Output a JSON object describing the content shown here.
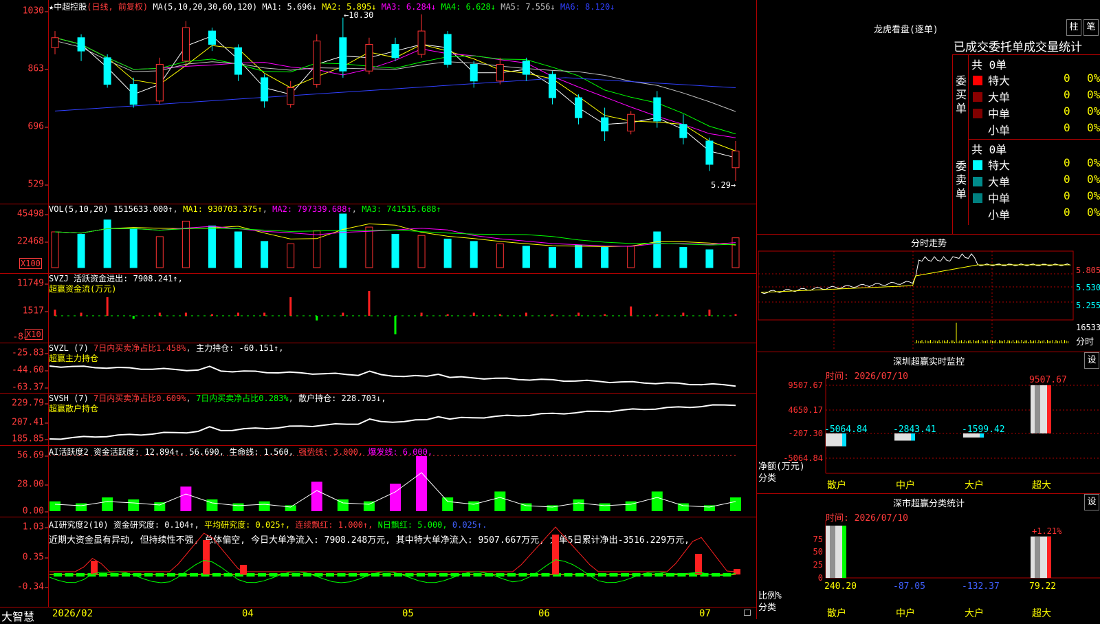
{
  "main": {
    "stock": "中超控股",
    "mode": "(日线, 前复权)",
    "ma_param": "MA(5,10,20,30,60,120)",
    "ma": [
      {
        "label": "MA1: 5.696↓",
        "color": "#ffffff"
      },
      {
        "label": "MA2: 5.895↓",
        "color": "#ffff00"
      },
      {
        "label": "MA3: 6.284↓",
        "color": "#ff00ff"
      },
      {
        "label": "MA4: 6.628↓",
        "color": "#00ff00"
      },
      {
        "label": "MA5: 7.556↓",
        "color": "#c0c0c0"
      },
      {
        "label": "MA6: 8.120↓",
        "color": "#3040ff"
      }
    ],
    "y_ticks": [
      "1030",
      "863",
      "696",
      "529"
    ],
    "high_label": "←10.30",
    "low_label": "5.29→"
  },
  "candles": [
    {
      "o": 9.3,
      "c": 9.6,
      "h": 9.8,
      "l": 9.1
    },
    {
      "o": 9.6,
      "c": 9.2,
      "h": 9.7,
      "l": 8.9
    },
    {
      "o": 9.0,
      "c": 8.2,
      "h": 9.1,
      "l": 8.1
    },
    {
      "o": 8.2,
      "c": 7.6,
      "h": 8.4,
      "l": 7.5
    },
    {
      "o": 7.7,
      "c": 8.8,
      "h": 9.0,
      "l": 7.6
    },
    {
      "o": 8.9,
      "c": 9.9,
      "h": 10.1,
      "l": 8.8
    },
    {
      "o": 9.8,
      "c": 9.4,
      "h": 9.9,
      "l": 9.2
    },
    {
      "o": 9.3,
      "c": 8.5,
      "h": 9.4,
      "l": 8.3
    },
    {
      "o": 8.4,
      "c": 7.7,
      "h": 8.5,
      "l": 7.5
    },
    {
      "o": 7.6,
      "c": 8.1,
      "h": 8.3,
      "l": 7.5
    },
    {
      "o": 8.2,
      "c": 9.5,
      "h": 9.7,
      "l": 8.1
    },
    {
      "o": 9.6,
      "c": 8.6,
      "h": 10.2,
      "l": 8.4
    },
    {
      "o": 8.6,
      "c": 9.4,
      "h": 9.6,
      "l": 8.5
    },
    {
      "o": 9.4,
      "c": 9.0,
      "h": 9.6,
      "l": 8.9
    },
    {
      "o": 9.1,
      "c": 9.8,
      "h": 10.3,
      "l": 9.0
    },
    {
      "o": 9.7,
      "c": 8.8,
      "h": 9.8,
      "l": 8.7
    },
    {
      "o": 8.8,
      "c": 8.3,
      "h": 8.9,
      "l": 8.1
    },
    {
      "o": 8.3,
      "c": 8.8,
      "h": 9.0,
      "l": 8.2
    },
    {
      "o": 8.9,
      "c": 8.5,
      "h": 9.0,
      "l": 8.3
    },
    {
      "o": 8.5,
      "c": 7.8,
      "h": 8.6,
      "l": 7.6
    },
    {
      "o": 7.8,
      "c": 7.2,
      "h": 7.9,
      "l": 7.0
    },
    {
      "o": 7.2,
      "c": 6.8,
      "h": 7.5,
      "l": 6.5
    },
    {
      "o": 6.8,
      "c": 7.3,
      "h": 7.4,
      "l": 6.7
    },
    {
      "o": 7.8,
      "c": 7.1,
      "h": 8.0,
      "l": 6.9
    },
    {
      "o": 7.0,
      "c": 6.6,
      "h": 7.3,
      "l": 6.4
    },
    {
      "o": 6.5,
      "c": 5.8,
      "h": 6.6,
      "l": 5.6
    },
    {
      "o": 5.7,
      "c": 6.2,
      "h": 6.5,
      "l": 5.3
    }
  ],
  "vol": {
    "title": "VOL(5,10,20)",
    "value": "1515633.000↑",
    "ma1": "MA1: 930703.375↑",
    "ma2": "MA2: 797339.688↑",
    "ma3": "MA3: 741515.688↑",
    "y_ticks": [
      "45498",
      "22468"
    ],
    "unit": "X100",
    "values": [
      30,
      28,
      40,
      33,
      26,
      39,
      35,
      30,
      22,
      20,
      31,
      45,
      34,
      28,
      27,
      24,
      22,
      20,
      18,
      17,
      19,
      17,
      18,
      30,
      17,
      15,
      25
    ]
  },
  "svzj": {
    "title": "SVZJ",
    "line1": "活跃资金进出: 7908.241↑,",
    "line2": "超赢资金流(万元)",
    "y_ticks": [
      "11749",
      "1517",
      "-8"
    ],
    "unit": "X10",
    "values": [
      0.2,
      0.1,
      0.6,
      -0.1,
      0.1,
      0.1,
      0.05,
      0.1,
      0.1,
      0.6,
      -0.15,
      0.1,
      0.8,
      -0.6,
      0.1,
      0.05,
      0.1,
      0.05,
      0.1,
      0.05,
      0.1,
      0.05,
      0.3,
      0.05,
      0.1,
      0.2,
      0.05
    ]
  },
  "svzl": {
    "title": "SVZL (7)",
    "line1a": "7日内买卖净占比1.458%",
    "line1b": "主力持仓: -60.151↑,",
    "line2": "超赢主力持仓",
    "y_ticks": [
      "-25.83",
      "-44.60",
      "-63.37"
    ]
  },
  "svsh": {
    "title": "SVSH (7)",
    "line1a": "7日内买卖净占比0.609%",
    "line1b": "7日内买卖净占比0.283%",
    "line1c": "散户持仓: 228.703↓,",
    "line2": "超赢散户持仓",
    "y_ticks": [
      "229.79",
      "207.41",
      "185.85"
    ]
  },
  "ai1": {
    "title": "AI活跃度2",
    "a": "资金活跃度: 12.894↑,",
    "b": "56.690,",
    "c": "生命线: 1.560,",
    "d": "强势线: 3.000,",
    "e": "爆发线: 6.000,",
    "y_ticks": [
      "56.69",
      "28.00",
      "0.00"
    ],
    "values": [
      10,
      8,
      14,
      12,
      9,
      25,
      12,
      8,
      10,
      6,
      30,
      12,
      10,
      28,
      56,
      14,
      10,
      20,
      8,
      6,
      12,
      8,
      10,
      20,
      8,
      6,
      14
    ]
  },
  "ai2": {
    "title": "AI研究度2(10)",
    "a": "资金研究度: 0.104↑,",
    "b": "平均研究度: 0.025↑,",
    "c": "连续飘红: 1.000↑,",
    "d": "N日飘红: 5.000,",
    "e": "0.025↑.",
    "note": "近期大资金虽有异动, 但持续性不强, 总体偏空, 今日大单净流入: 7908.248万元, 其中特大单净流入: 9507.667万元, 大单5日累计净出-3516.229万元,",
    "y_ticks": [
      "1.03",
      "0.35",
      "-0.34"
    ]
  },
  "xaxis": [
    "2026/02",
    "04",
    "05",
    "06",
    "07"
  ],
  "brand": "大智慧",
  "lhb": {
    "title": "龙虎看盘(逐单)",
    "btn_bar": "柱",
    "btn_pen": "笔",
    "subtitle": "已成交委托单成交量统计",
    "buy": {
      "side": "委买单",
      "total": "共 0单",
      "rows": [
        {
          "name": "特大",
          "count": "0",
          "pct": "0%",
          "color": "#ff0000"
        },
        {
          "name": "大单",
          "count": "0",
          "pct": "0%",
          "color": "#8b0000"
        },
        {
          "name": "中单",
          "count": "0",
          "pct": "0%",
          "color": "#800000"
        },
        {
          "name": "小单",
          "count": "0",
          "pct": "0%",
          "color": "#000000"
        }
      ]
    },
    "sell": {
      "side": "委卖单",
      "total": "共 0单",
      "rows": [
        {
          "name": "特大",
          "count": "0",
          "pct": "0%",
          "color": "#00ffff"
        },
        {
          "name": "大单",
          "count": "0",
          "pct": "0%",
          "color": "#008b8b"
        },
        {
          "name": "中单",
          "count": "0",
          "pct": "0%",
          "color": "#008080"
        },
        {
          "name": "小单",
          "count": "0",
          "pct": "0%",
          "color": "#000000"
        }
      ]
    }
  },
  "fenshi": {
    "title": "分时走势",
    "y_ticks": [
      "5.805",
      "5.530",
      "5.255"
    ],
    "vol_tick": "16533",
    "vol_unit": "分时"
  },
  "monitor": {
    "title": "深圳超赢实时监控",
    "btn": "设",
    "time": "时间: 2026/07/10",
    "y_ticks": [
      "9507.67",
      "4650.17",
      "-207.30",
      "-5064.84"
    ],
    "y_label": "净额(万元)",
    "x_label": "分类",
    "chart_data": {
      "type": "bar",
      "categories": [
        "散户",
        "中户",
        "大户",
        "超大"
      ],
      "values": [
        -5064.84,
        -2843.41,
        -1599.42,
        9507.67
      ],
      "ylim": [
        -5064.84,
        9507.67
      ]
    },
    "value_labels": [
      "-5064.84",
      "-2843.41",
      "-1599.42",
      "9507.67"
    ]
  },
  "classify": {
    "title": "深市超赢分类统计",
    "btn": "设",
    "time": "时间: 2026/07/10",
    "y_ticks": [
      "75",
      "50",
      "25",
      "0"
    ],
    "y_label": "比例%",
    "x_label": "分类",
    "chart_data": {
      "type": "bar",
      "categories": [
        "散户",
        "中户",
        "大户",
        "超大"
      ],
      "values": [
        240.2,
        -87.05,
        -132.37,
        79.22
      ],
      "ylim": [
        0,
        100
      ]
    },
    "value_labels": [
      "240.20",
      "-87.05",
      "-132.37",
      "79.22"
    ],
    "top_label": "+1.21%"
  }
}
